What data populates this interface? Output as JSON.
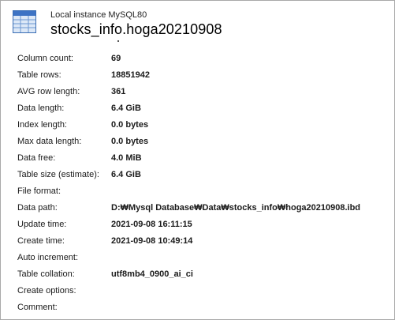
{
  "header": {
    "instance": "Local instance MySQL80",
    "title": "stocks_info.hoga20210908",
    "icon": "table-icon"
  },
  "properties": [
    {
      "label": "Column count:",
      "value": "69"
    },
    {
      "label": "Table rows:",
      "value": "18851942"
    },
    {
      "label": "AVG row length:",
      "value": "361"
    },
    {
      "label": "Data length:",
      "value": "6.4 GiB"
    },
    {
      "label": "Index length:",
      "value": "0.0 bytes"
    },
    {
      "label": "Max data length:",
      "value": "0.0 bytes"
    },
    {
      "label": "Data free:",
      "value": "4.0 MiB"
    },
    {
      "label": "Table size (estimate):",
      "value": "6.4 GiB"
    },
    {
      "label": "File format:",
      "value": ""
    },
    {
      "label": "Data path:",
      "value": "D:₩Mysql Database₩Data₩stocks_info₩hoga20210908.ibd"
    },
    {
      "label": "Update time:",
      "value": "2021-09-08 16:11:15"
    },
    {
      "label": "Create time:",
      "value": "2021-09-08 10:49:14"
    },
    {
      "label": "Auto increment:",
      "value": ""
    },
    {
      "label": "Table collation:",
      "value": "utf8mb4_0900_ai_ci"
    },
    {
      "label": "Create options:",
      "value": ""
    },
    {
      "label": "Comment:",
      "value": ""
    }
  ]
}
